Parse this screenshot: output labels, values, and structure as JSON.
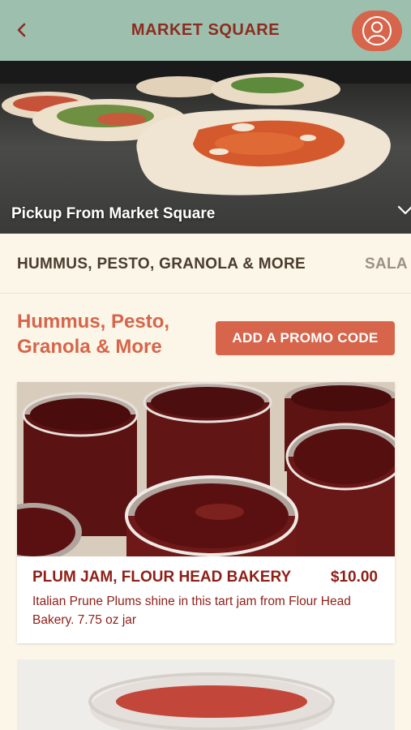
{
  "header": {
    "title": "MARKET SQUARE"
  },
  "hero": {
    "location_label": "Pickup From Market Square"
  },
  "tabs": [
    {
      "label": "HUMMUS, PESTO, GRANOLA & MORE"
    },
    {
      "label": "SALA"
    }
  ],
  "section": {
    "title": "Hummus, Pesto, Granola & More",
    "promo_label": "ADD A PROMO CODE"
  },
  "products": [
    {
      "name": "PLUM JAM, FLOUR HEAD BAKERY",
      "price": "$10.00",
      "description": "Italian Prune Plums shine in this tart jam from Flour Head Bakery. 7.75 oz jar"
    }
  ],
  "colors": {
    "header_bg": "#9cbfae",
    "accent": "#d6654b",
    "title_red": "#8e2b1f",
    "page_bg": "#fbf6e8"
  },
  "icons": {
    "back": "chevron-left-icon",
    "profile": "user-icon",
    "expand": "chevron-down-icon"
  }
}
